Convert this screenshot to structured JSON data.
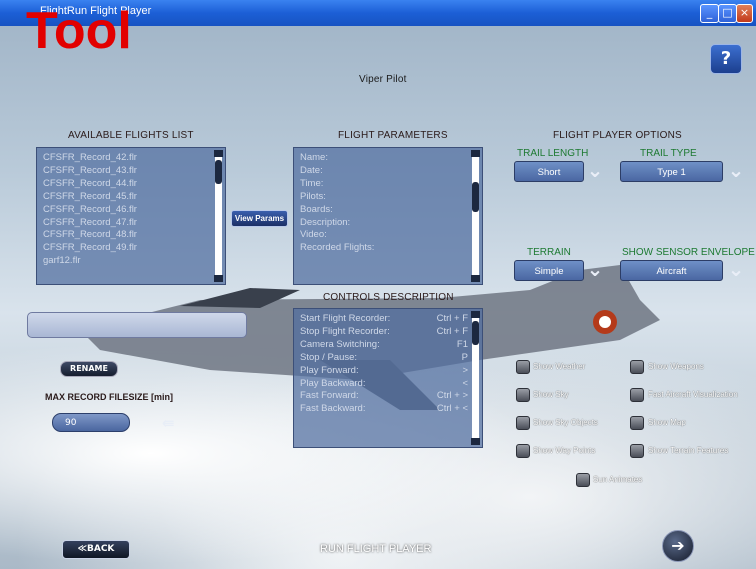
{
  "window": {
    "title": "FlightRun Flight Player",
    "overlay_text": "Tool"
  },
  "header": {
    "pilot_name": "Viper Pilot",
    "help_label": "?"
  },
  "available_flights": {
    "title": "AVAILABLE FLIGHTS LIST",
    "items": [
      "CFSFR_Record_42.flr",
      "CFSFR_Record_43.flr",
      "CFSFR_Record_44.flr",
      "CFSFR_Record_45.flr",
      "CFSFR_Record_46.flr",
      "CFSFR_Record_47.flr",
      "CFSFR_Record_48.flr",
      "CFSFR_Record_49.flr",
      "garf12.flr"
    ],
    "view_params_label": "View Params"
  },
  "flight_parameters": {
    "title": "FLIGHT PARAMETERS",
    "fields": [
      "Name:",
      "Date:",
      "Time:",
      "Pilots:",
      "Boards:",
      "Description:",
      "Video:",
      "Recorded Flights:"
    ]
  },
  "options": {
    "title": "FLIGHT PLAYER OPTIONS",
    "trail_length": {
      "label": "TRAIL LENGTH",
      "value": "Short"
    },
    "trail_type": {
      "label": "TRAIL TYPE",
      "value": "Type 1"
    },
    "terrain": {
      "label": "TERRAIN",
      "value": "Simple"
    },
    "sensor_envelope": {
      "label": "SHOW SENSOR ENVELOPE",
      "value": "Aircraft"
    }
  },
  "controls": {
    "title": "CONTROLS DESCRIPTION",
    "rows": [
      {
        "action": "Start Flight Recorder:",
        "key": "Ctrl + F"
      },
      {
        "action": "Stop Flight Recorder:",
        "key": "Ctrl + F"
      },
      {
        "action": "Camera Switching:",
        "key": "F1"
      },
      {
        "action": "Stop / Pause:",
        "key": "P"
      },
      {
        "action": "Play Forward:",
        "key": ">"
      },
      {
        "action": "Play Backward:",
        "key": "<"
      },
      {
        "action": "Fast Forward:",
        "key": "Ctrl + >"
      },
      {
        "action": "Fast Backward:",
        "key": "Ctrl + <"
      }
    ]
  },
  "checkboxes": {
    "show_weather": "Show Weather",
    "show_weapons": "Show Weapons",
    "show_sky": "Show Sky",
    "fast_aircraft_visualization": "Fast Aircraft Visualization",
    "show_sky_objects": "Show Sky Objects",
    "show_map": "Show Map",
    "show_way_points": "Show Way Points",
    "show_terrain_features": "Show Terrain Features",
    "sun_animates": "Sun Animates"
  },
  "rename_label": "RENAME",
  "max_record": {
    "label": "MAX RECORD FILESIZE [min]",
    "value": "90"
  },
  "footer": {
    "back_label": "BACK",
    "run_label": "RUN FLIGHT PLAYER"
  }
}
